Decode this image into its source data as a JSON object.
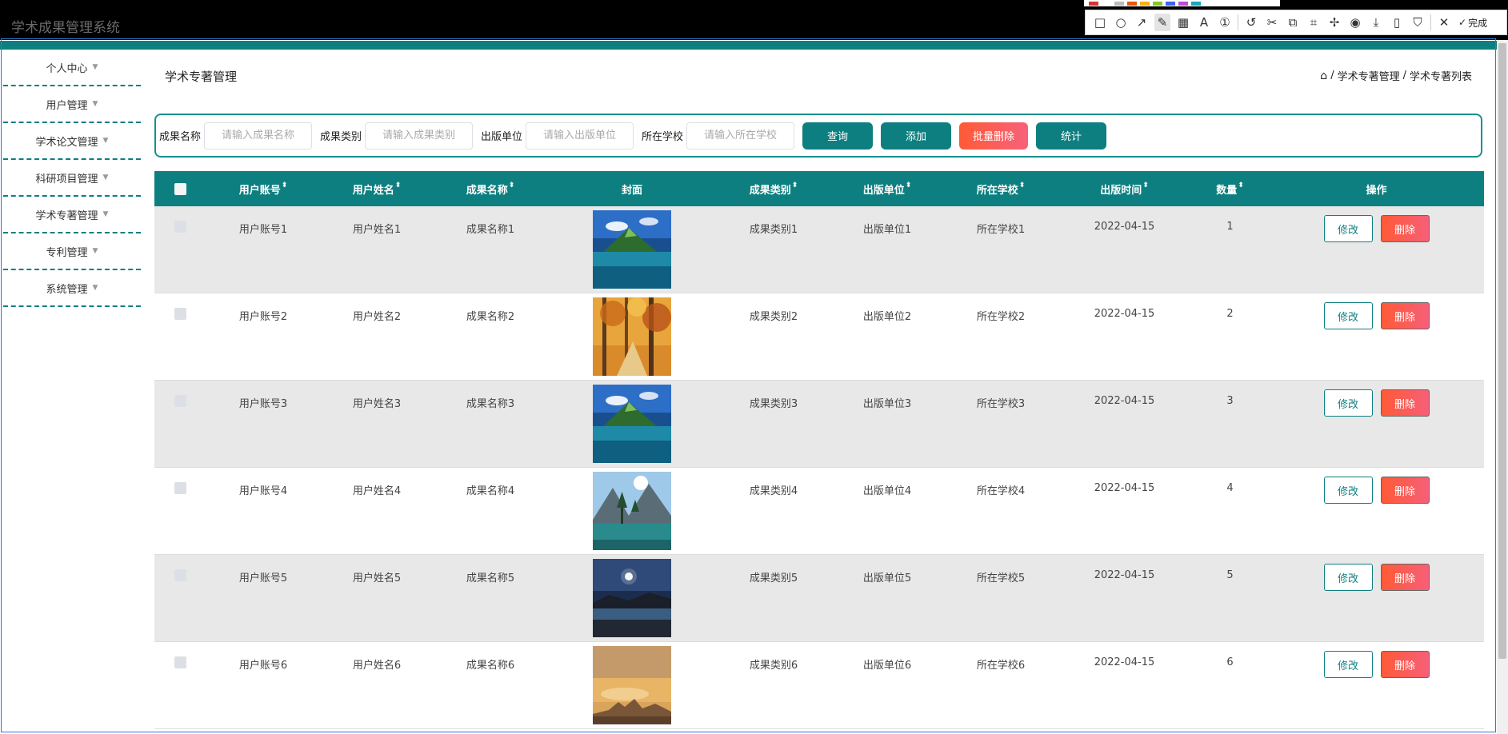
{
  "app": {
    "title": "学术成果管理系统"
  },
  "annotation_toolbar": {
    "swatches": [
      "#e03131",
      "#ffffff",
      "#bbbbbb",
      "#e8590c",
      "#fab005",
      "#82c91e",
      "#4263eb",
      "#be4bdb",
      "#15aabf"
    ],
    "tools": [
      {
        "icon": "rectangle-icon",
        "glyph": "□"
      },
      {
        "icon": "circle-icon",
        "glyph": "○"
      },
      {
        "icon": "arrow-icon",
        "glyph": "↗"
      },
      {
        "icon": "pen-icon",
        "glyph": "✎"
      },
      {
        "icon": "mosaic-icon",
        "glyph": "▦"
      },
      {
        "icon": "text-icon",
        "glyph": "A"
      },
      {
        "icon": "number-icon",
        "glyph": "①"
      },
      {
        "icon": "undo-icon",
        "glyph": "↺"
      },
      {
        "icon": "scissors-icon",
        "glyph": "✂"
      },
      {
        "icon": "translate-icon",
        "glyph": "⧉"
      },
      {
        "icon": "ocr-icon",
        "glyph": "⌗"
      },
      {
        "icon": "pin-icon",
        "glyph": "✢"
      },
      {
        "icon": "record-icon",
        "glyph": "◉"
      },
      {
        "icon": "download-icon",
        "glyph": "⤓"
      },
      {
        "icon": "phone-icon",
        "glyph": "▯"
      },
      {
        "icon": "bookmark-icon",
        "glyph": "⛉"
      }
    ],
    "close_glyph": "✕",
    "done_glyph": "✓",
    "done_label": "完成"
  },
  "sidebar": {
    "items": [
      {
        "label": "个人中心"
      },
      {
        "label": "用户管理"
      },
      {
        "label": "学术论文管理"
      },
      {
        "label": "科研项目管理"
      },
      {
        "label": "学术专著管理"
      },
      {
        "label": "专利管理"
      },
      {
        "label": "系统管理"
      }
    ],
    "caret": "▼"
  },
  "main": {
    "page_title": "学术专著管理",
    "breadcrumb": {
      "home_glyph": "⌂",
      "sep": "/",
      "items": [
        "学术专著管理",
        "学术专著列表"
      ]
    }
  },
  "search": {
    "fields": [
      {
        "label": "成果名称",
        "placeholder": "请输入成果名称"
      },
      {
        "label": "成果类别",
        "placeholder": "请输入成果类别"
      },
      {
        "label": "出版单位",
        "placeholder": "请输入出版单位"
      },
      {
        "label": "所在学校",
        "placeholder": "请输入所在学校"
      }
    ],
    "query_label": "查询",
    "add_label": "添加",
    "batch_delete_label": "批量删除",
    "stats_label": "统计"
  },
  "table": {
    "sort_glyph": "⬍",
    "headers": {
      "account": "用户账号",
      "name": "用户姓名",
      "result": "成果名称",
      "cover": "封面",
      "type": "成果类别",
      "publisher": "出版单位",
      "school": "所在学校",
      "date": "出版时间",
      "count": "数量",
      "op": "操作"
    },
    "edit_label": "修改",
    "delete_label": "删除",
    "rows": [
      {
        "account": "用户账号1",
        "name": "用户姓名1",
        "result": "成果名称1",
        "cover": "lake-mountain",
        "type": "成果类别1",
        "publisher": "出版单位1",
        "school": "所在学校1",
        "date": "2022-04-15",
        "count": "1"
      },
      {
        "account": "用户账号2",
        "name": "用户姓名2",
        "result": "成果名称2",
        "cover": "autumn-forest",
        "type": "成果类别2",
        "publisher": "出版单位2",
        "school": "所在学校2",
        "date": "2022-04-15",
        "count": "2"
      },
      {
        "account": "用户账号3",
        "name": "用户姓名3",
        "result": "成果名称3",
        "cover": "lake-mountain",
        "type": "成果类别3",
        "publisher": "出版单位3",
        "school": "所在学校3",
        "date": "2022-04-15",
        "count": "3"
      },
      {
        "account": "用户账号4",
        "name": "用户姓名4",
        "result": "成果名称4",
        "cover": "alpine-river",
        "type": "成果类别4",
        "publisher": "出版单位4",
        "school": "所在学校4",
        "date": "2022-04-15",
        "count": "4"
      },
      {
        "account": "用户账号5",
        "name": "用户姓名5",
        "result": "成果名称5",
        "cover": "night-lake",
        "type": "成果类别5",
        "publisher": "出版单位5",
        "school": "所在学校5",
        "date": "2022-04-15",
        "count": "5"
      },
      {
        "account": "用户账号6",
        "name": "用户姓名6",
        "result": "成果名称6",
        "cover": "sunset-clouds",
        "type": "成果类别6",
        "publisher": "出版单位6",
        "school": "所在学校6",
        "date": "2022-04-15",
        "count": "6"
      }
    ]
  },
  "colors": {
    "primary": "#0e7f80",
    "danger": "#ff5a36"
  }
}
